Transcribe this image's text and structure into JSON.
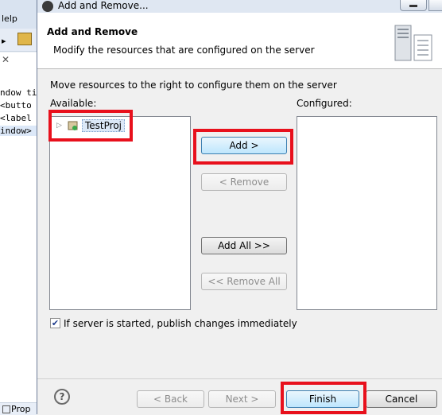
{
  "background_ide": {
    "menu_fragment": "lelp",
    "code_lines": [
      "ndow ti",
      " <butto",
      " <label",
      "indow>"
    ],
    "bottom_tab": "Prop"
  },
  "dialog": {
    "title": "Add and Remove...",
    "header": {
      "title": "Add and Remove",
      "description": "Modify the resources that are configured on the server"
    },
    "instruction": "Move resources to the right to configure them on the server",
    "available_label": "Available:",
    "configured_label": "Configured:",
    "available_items": [
      {
        "name": "TestProj"
      }
    ],
    "configured_items": [],
    "buttons": {
      "add": "Add >",
      "remove": "< Remove",
      "add_all": "Add All >>",
      "remove_all": "<< Remove All",
      "back": "< Back",
      "next": "Next >",
      "finish": "Finish",
      "cancel": "Cancel"
    },
    "publish_checkbox": {
      "label": "If server is started, publish changes immediately",
      "checked": true
    },
    "help_glyph": "?"
  },
  "highlight_color": "#e8101c"
}
